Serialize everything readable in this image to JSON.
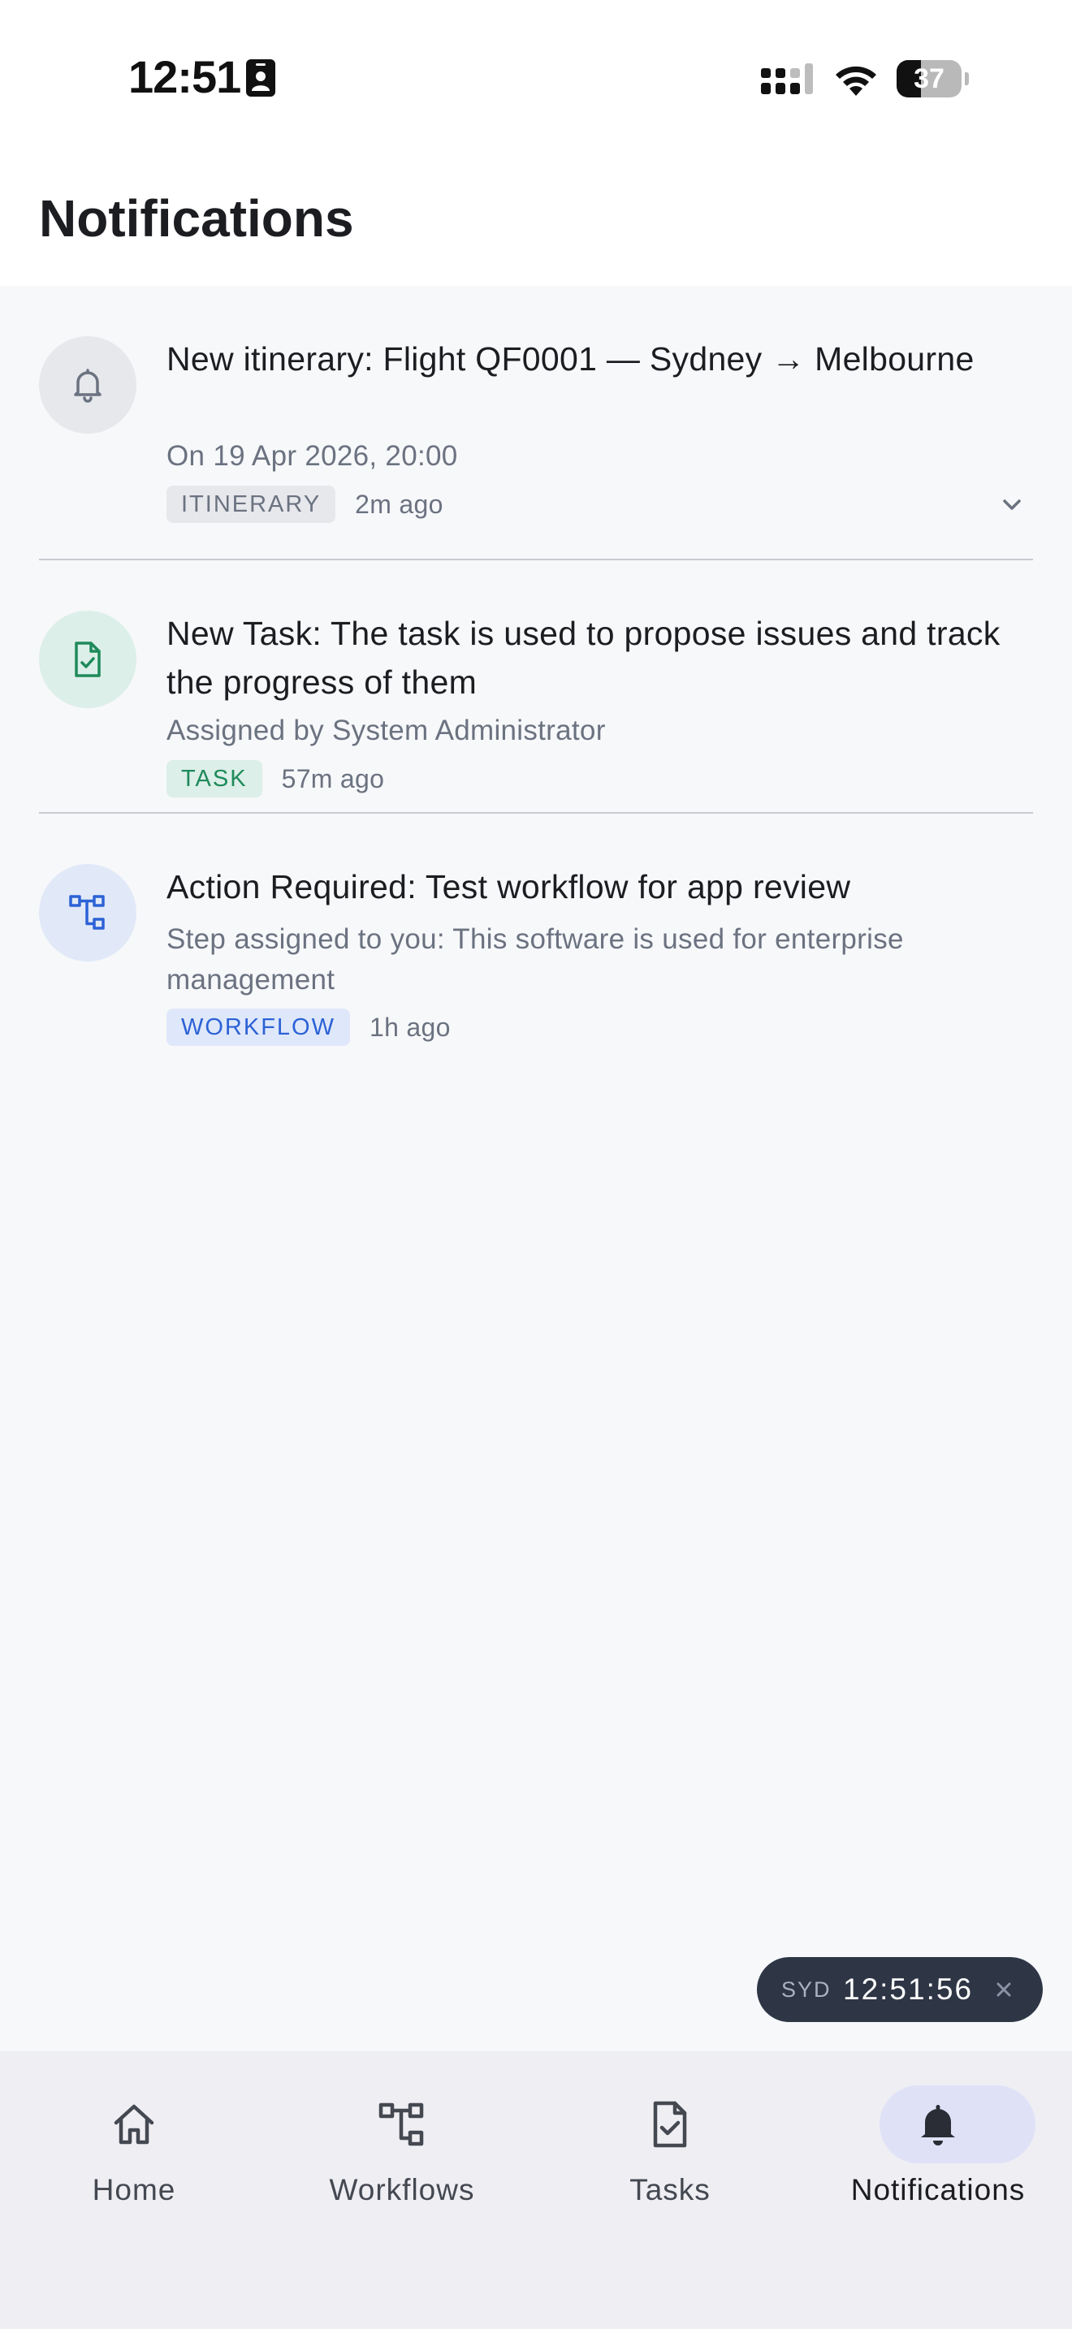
{
  "status_bar": {
    "time": "12:51",
    "battery": "37",
    "battery_level": 0.37
  },
  "header": {
    "title": "Notifications"
  },
  "notifications": [
    {
      "title": "New itinerary: Flight QF0001 — Sydney → Melbourne",
      "subtitle": "On 19 Apr 2026, 20:00",
      "tag": "ITINERARY",
      "time_ago": "2m ago",
      "icon": "bell-icon",
      "expandable": true
    },
    {
      "title": "New Task: The task is used to propose issues and track the progress of them",
      "subtitle": "Assigned by System Administrator",
      "tag": "TASK",
      "time_ago": "57m ago",
      "icon": "document-check-icon"
    },
    {
      "title": "Action Required: Test workflow for app review",
      "subtitle": "Step assigned to you: This software is used for enterprise management",
      "tag": "WORKFLOW",
      "time_ago": "1h ago",
      "icon": "workflow-icon"
    }
  ],
  "clock_widget": {
    "label": "SYD",
    "time": "12:51:56"
  },
  "tabs": [
    {
      "label": "Home",
      "icon": "home-icon"
    },
    {
      "label": "Workflows",
      "icon": "workflow-icon"
    },
    {
      "label": "Tasks",
      "icon": "document-check-icon"
    },
    {
      "label": "Notifications",
      "icon": "bell-icon",
      "active": true
    }
  ],
  "colors": {
    "accent_blue": "#2c62d6",
    "accent_green": "#1f8a5b",
    "clock_bg": "#2e3646",
    "tab_active_pill": "#dfe2f7"
  }
}
